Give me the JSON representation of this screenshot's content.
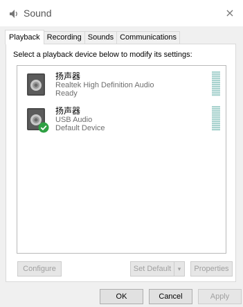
{
  "window": {
    "title": "Sound",
    "close_glyph": "×"
  },
  "tabs": [
    {
      "label": "Playback",
      "active": true
    },
    {
      "label": "Recording",
      "active": false
    },
    {
      "label": "Sounds",
      "active": false
    },
    {
      "label": "Communications",
      "active": false
    }
  ],
  "panel": {
    "instruction": "Select a playback device below to modify its settings:"
  },
  "devices": [
    {
      "name": "扬声器",
      "description": "Realtek High Definition Audio",
      "status": "Ready",
      "icon": "speaker-icon",
      "default": false
    },
    {
      "name": "扬声器",
      "description": "USB Audio",
      "status": "Default Device",
      "icon": "speaker-icon",
      "default": true
    }
  ],
  "panel_buttons": {
    "configure": "Configure",
    "set_default": "Set Default",
    "set_default_arrow": "▾",
    "properties": "Properties"
  },
  "dialog_buttons": {
    "ok": "OK",
    "cancel": "Cancel",
    "apply": "Apply"
  },
  "colors": {
    "accent_check": "#2ea043",
    "level_meter": "#a9d3cf",
    "dialog_bg": "#f0f0f0"
  }
}
